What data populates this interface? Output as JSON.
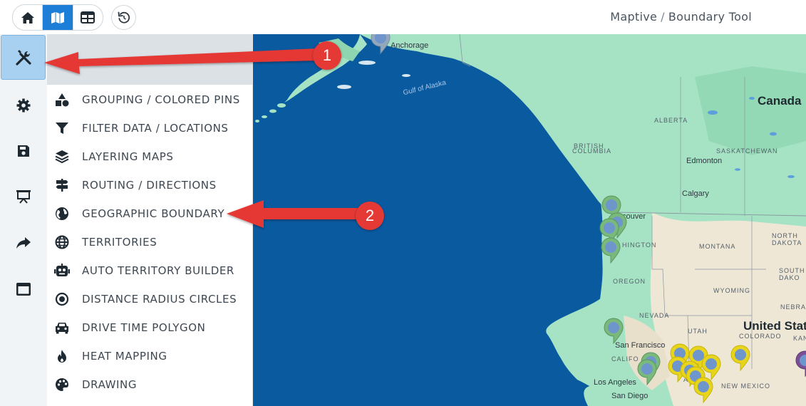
{
  "header": {
    "breadcrumb_app": "Maptive",
    "breadcrumb_separator": "/",
    "breadcrumb_page": "Boundary Tool",
    "view_toggle": [
      {
        "icon": "home-icon",
        "active": false
      },
      {
        "icon": "map-icon",
        "active": true
      },
      {
        "icon": "table-icon",
        "active": false
      }
    ],
    "reset_icon": "undo-icon"
  },
  "rail": {
    "items": [
      {
        "icon": "tools-icon",
        "active": true
      },
      {
        "icon": "gear-icon",
        "active": false
      },
      {
        "icon": "save-icon",
        "active": false
      },
      {
        "icon": "presentation-icon",
        "active": false
      },
      {
        "icon": "share-icon",
        "active": false
      },
      {
        "icon": "window-icon",
        "active": false
      }
    ]
  },
  "panel": {
    "close_icon": "close-icon",
    "items": [
      {
        "label": "GROUPING / COLORED PINS",
        "icon": "shapes-icon"
      },
      {
        "label": "FILTER DATA / LOCATIONS",
        "icon": "filter-icon"
      },
      {
        "label": "LAYERING MAPS",
        "icon": "layers-icon"
      },
      {
        "label": "ROUTING / DIRECTIONS",
        "icon": "signpost-icon"
      },
      {
        "label": "GEOGRAPHIC BOUNDARY",
        "icon": "globe-icon"
      },
      {
        "label": "TERRITORIES",
        "icon": "globe-grid-icon"
      },
      {
        "label": "AUTO TERRITORY BUILDER",
        "icon": "robot-icon"
      },
      {
        "label": "DISTANCE RADIUS CIRCLES",
        "icon": "radius-icon"
      },
      {
        "label": "DRIVE TIME POLYGON",
        "icon": "car-icon"
      },
      {
        "label": "HEAT MAPPING",
        "icon": "fire-icon"
      },
      {
        "label": "DRAWING",
        "icon": "palette-icon"
      }
    ]
  },
  "map": {
    "labels": {
      "anchorage": "Anchorage",
      "gulf": "Gulf of Alaska",
      "canada": "Canada",
      "alberta": "ALBERTA",
      "bc1": "BRITISH",
      "bc2": "COLUMBIA",
      "saskatchewan": "SASKATCHEWAN",
      "edmonton": "Edmonton",
      "calgary": "Calgary",
      "vancouver": "couver",
      "washington": "HINGTON",
      "montana": "MONTANA",
      "north1": "NORTH",
      "north2": "DAKOTA",
      "south1": "SOUTH",
      "south2": "DAKO",
      "oregon": "OREGON",
      "wyoming": "WYOMING",
      "united_states": "United Stat",
      "nevada": "NEVADA",
      "utah": "UTAH",
      "colorado": "COLORADO",
      "nebraska": "NEBRAS",
      "kansas": "KANS",
      "san_francisco": "San Francisco",
      "california": "CALIFO",
      "ari": "ARI",
      "new_mexico": "NEW MEXICO",
      "los_angeles": "Los Angeles",
      "san_diego": "San Diego"
    }
  },
  "annotations": [
    {
      "number": "1"
    },
    {
      "number": "2"
    }
  ]
}
